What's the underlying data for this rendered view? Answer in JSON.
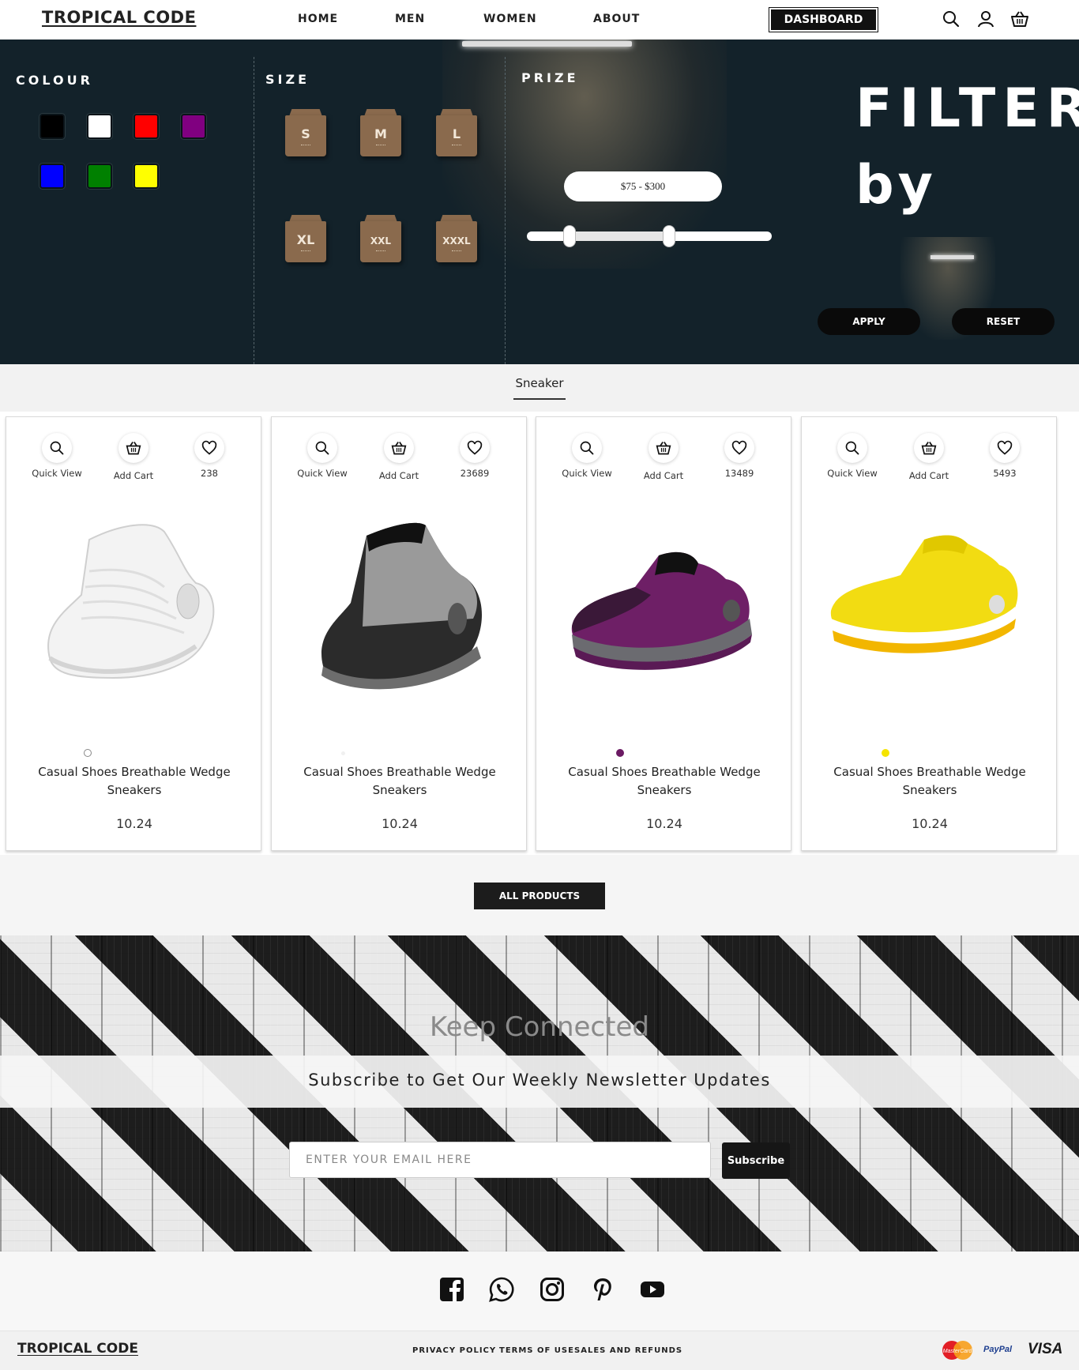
{
  "header": {
    "logo": "TROPICAL CODE",
    "nav": [
      "HOME",
      "MEN",
      "WOMEN",
      "ABOUT"
    ],
    "dashboard_label": "DASHBOARD",
    "icons": [
      "search-icon",
      "user-icon",
      "basket-icon"
    ]
  },
  "filter": {
    "colour_heading": "COLOUR",
    "size_heading": "SIZE",
    "prize_heading": "PRIZE",
    "colours": [
      "#000000",
      "#ffffff",
      "#ff0000",
      "#800080",
      "#0000ff",
      "#008000",
      "#ffff00"
    ],
    "sizes": [
      "S",
      "M",
      "L",
      "XL",
      "XXL",
      "XXXL"
    ],
    "price_range_label": "$75 - $300",
    "price_min": 75,
    "price_max": 300,
    "title_line1": "FILTER",
    "title_line2": "by",
    "apply_label": "APPLY",
    "reset_label": "RESET"
  },
  "category": {
    "active_tab": "Sneaker"
  },
  "products": [
    {
      "quick_view": "Quick View",
      "add_cart": "Add Cart",
      "likes": "238",
      "title": "Casual Shoes Breathable Wedge Sneakers",
      "price": "10.24",
      "color": "#ffffff",
      "shoe": "white"
    },
    {
      "quick_view": "Quick View",
      "add_cart": "Add Cart",
      "likes": "23689",
      "title": "Casual Shoes Breathable Wedge Sneakers",
      "price": "10.24",
      "color": "#f0f0f0",
      "shoe": "grey"
    },
    {
      "quick_view": "Quick View",
      "add_cart": "Add Cart",
      "likes": "13489",
      "title": "Casual Shoes Breathable Wedge Sneakers",
      "price": "10.24",
      "color": "#6b1a63",
      "shoe": "purple"
    },
    {
      "quick_view": "Quick View",
      "add_cart": "Add Cart",
      "likes": "5493",
      "title": "Casual Shoes Breathable Wedge Sneakers",
      "price": "10.24",
      "color": "#f5e400",
      "shoe": "yellow"
    }
  ],
  "all_products_label": "ALL PRODUCTS",
  "newsletter": {
    "heading": "Keep Connected",
    "subheading": "Subscribe to Get Our Weekly Newsletter Updates",
    "email_placeholder": "ENTER YOUR EMAIL HERE",
    "subscribe_label": "Subscribe"
  },
  "social": [
    "facebook-icon",
    "whatsapp-icon",
    "instagram-icon",
    "pinterest-icon",
    "youtube-icon"
  ],
  "footer": {
    "logo": "TROPICAL CODE",
    "links": [
      "PRIVACY POLICY",
      "TERMS OF USE",
      "SALES AND REFUNDS"
    ],
    "payments": {
      "mastercard": "MasterCard",
      "paypal": "PayPal",
      "visa": "VISA"
    }
  }
}
